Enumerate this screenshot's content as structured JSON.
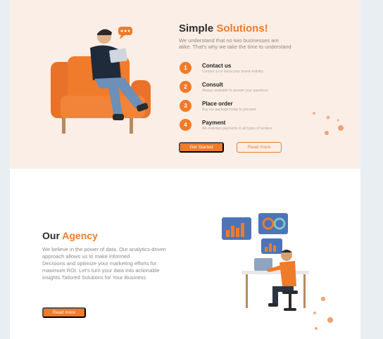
{
  "hero": {
    "title_plain": "Simple",
    "title_accent": "Solutions!",
    "description": "We understand that no two businesses are alike. That's why we take the time to understand",
    "steps": [
      {
        "num": "1",
        "title": "Contact us",
        "subtitle": "Contact us to boost your brand visibility"
      },
      {
        "num": "2",
        "title": "Consult",
        "subtitle": "Always available to answer your questions"
      },
      {
        "num": "3",
        "title": "Place order",
        "subtitle": "Buy our package today to proceed"
      },
      {
        "num": "4",
        "title": "Payment",
        "subtitle": "We maintain payments in all types of tenders"
      }
    ],
    "primary_button": "Get Started",
    "secondary_button": "Read more"
  },
  "agency": {
    "title_plain": "Our",
    "title_accent": "Agency",
    "paragraphs": [
      "We believe in the power of data. Our analytics-driven approach allows us to make informed",
      "Decisions and optimize your marketing efforts for maximum ROI. Let's turn your data into actionable insights.Tailored Solutions for Your Business"
    ],
    "button": "Read more"
  },
  "colors": {
    "accent": "#f07b2a",
    "hero_background": "#fbeee6",
    "page_background": "#ffffff",
    "outer_background": "#e9eef2"
  },
  "icons": {
    "hero_illustration": "person-in-armchair-with-tablet",
    "agency_illustration": "person-at-desk-with-charts"
  }
}
